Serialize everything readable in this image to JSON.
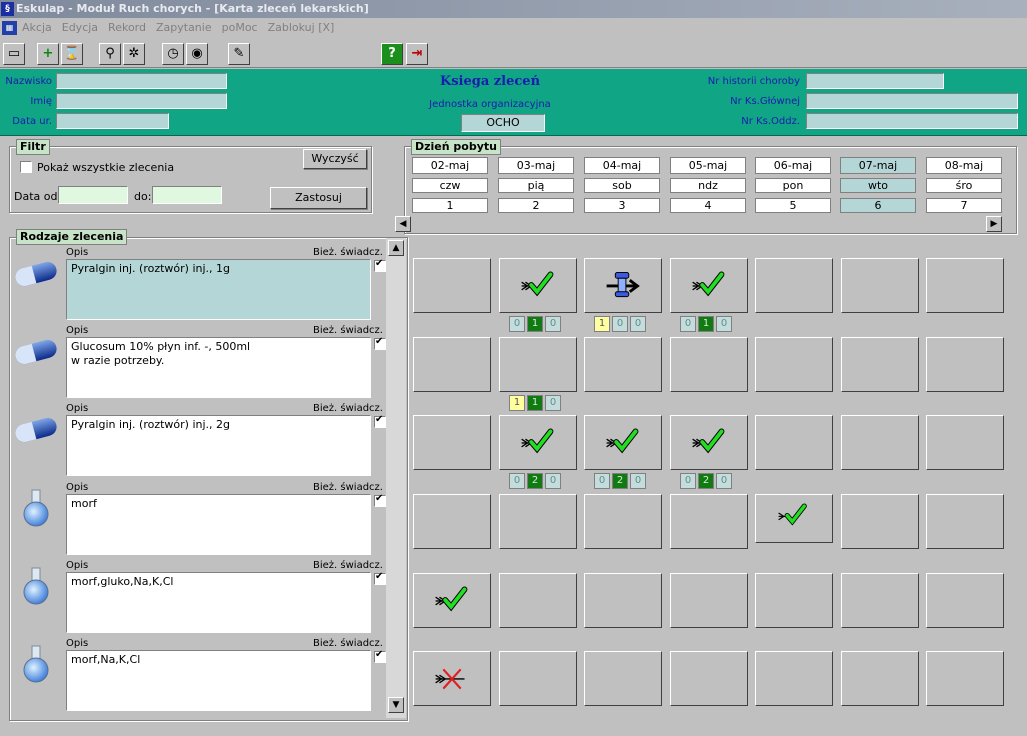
{
  "window": {
    "title": "Eskulap - Moduł Ruch chorych - [Karta zleceń lekarskich]"
  },
  "menu": [
    "Akcja",
    "Edycja",
    "Rekord",
    "Zapytanie",
    "poMoc",
    "Zablokuj [X]"
  ],
  "header": {
    "nazwisko_label": "Nazwisko",
    "imie_label": "Imię",
    "data_ur_label": "Data ur.",
    "title": "Ksiega zleceń",
    "jednostka_label": "Jednostka organizacyjna",
    "jednostka_value": "OCHO",
    "nr_historii_label": "Nr historii choroby",
    "nr_ks_glownej_label": "Nr Ks.Głównej",
    "nr_ks_oddz_label": "Nr Ks.Oddz."
  },
  "filter": {
    "title": "Filtr",
    "show_all_label": "Pokaż wszystkie zlecenia",
    "clear_button": "Wyczyść",
    "date_from_label": "Data od:",
    "date_to_label": "do:",
    "apply_button": "Zastosuj"
  },
  "days": {
    "title": "Dzień pobytu",
    "dates": [
      "02-maj",
      "03-maj",
      "04-maj",
      "05-maj",
      "06-maj",
      "07-maj",
      "08-maj"
    ],
    "weekdays": [
      "czw",
      "pią",
      "sob",
      "ndz",
      "pon",
      "wto",
      "śro"
    ],
    "numbers": [
      "1",
      "2",
      "3",
      "4",
      "5",
      "6",
      "7"
    ],
    "selected_index": 5
  },
  "orders_panel": {
    "title": "Rodzaje zlecenia"
  },
  "orders": [
    {
      "icon": "capsule-icon",
      "opis_label": "Opis",
      "biez_label": "Bież. świadcz.",
      "text": "Pyralgin inj. (roztwór) inj., 1g",
      "checked": true,
      "selected": true
    },
    {
      "icon": "capsule-icon",
      "opis_label": "Opis",
      "biez_label": "Bież. świadcz.",
      "text": "Glucosum 10% płyn inf. -, 500ml\nw razie potrzeby.",
      "checked": true,
      "selected": false
    },
    {
      "icon": "capsule-icon",
      "opis_label": "Opis",
      "biez_label": "Bież. świadcz.",
      "text": "Pyralgin inj. (roztwór) inj., 2g",
      "checked": true,
      "selected": false
    },
    {
      "icon": "flask-icon",
      "opis_label": "Opis",
      "biez_label": "Bież. świadcz.",
      "text": "morf",
      "checked": true,
      "selected": false
    },
    {
      "icon": "flask-icon",
      "opis_label": "Opis",
      "biez_label": "Bież. świadcz.",
      "text": "morf,gluko,Na,K,Cl",
      "checked": true,
      "selected": false
    },
    {
      "icon": "flask-icon",
      "opis_label": "Opis",
      "biez_label": "Bież. świadcz.",
      "text": "morf,Na,K,Cl",
      "checked": true,
      "selected": false
    }
  ],
  "grid": [
    [
      {},
      {
        "mark": "check",
        "counts": [
          "0",
          "1",
          "0"
        ],
        "styles": [
          "",
          "g",
          ""
        ]
      },
      {
        "mark": "drip"
      },
      {
        "mark": "check",
        "counts": [
          "0",
          "1",
          "0"
        ],
        "styles": [
          "",
          "g",
          ""
        ]
      },
      {},
      {},
      {}
    ],
    [
      {},
      {},
      {},
      {},
      {},
      {},
      {}
    ],
    [
      {},
      {
        "mark": "check",
        "counts": [
          "0",
          "2",
          "0"
        ],
        "styles": [
          "",
          "g",
          ""
        ]
      },
      {
        "mark": "check",
        "counts": [
          "0",
          "2",
          "0"
        ],
        "styles": [
          "",
          "g",
          ""
        ]
      },
      {
        "mark": "check",
        "counts": [
          "0",
          "2",
          "0"
        ],
        "styles": [
          "",
          "g",
          ""
        ]
      },
      {},
      {},
      {}
    ],
    [
      {},
      {},
      {},
      {},
      {
        "mark": "check-float"
      },
      {},
      {}
    ],
    [
      {
        "mark": "check"
      },
      {},
      {},
      {},
      {},
      {},
      {}
    ],
    [
      {
        "mark": "cross"
      },
      {},
      {},
      {},
      {},
      {},
      {}
    ]
  ],
  "extra_counts": [
    {
      "row": 0,
      "col": 2,
      "counts": [
        "1",
        "0",
        "0"
      ],
      "styles": [
        "y",
        "",
        ""
      ]
    },
    {
      "row": 1,
      "col": 1,
      "counts": [
        "1",
        "1",
        "0"
      ],
      "styles": [
        "y",
        "g",
        ""
      ]
    }
  ],
  "colors": {
    "header_bg": "#10a584",
    "label_blue": "#1b1bb0",
    "field_bg": "#b4d6d6",
    "check_green": "#22dd22"
  }
}
